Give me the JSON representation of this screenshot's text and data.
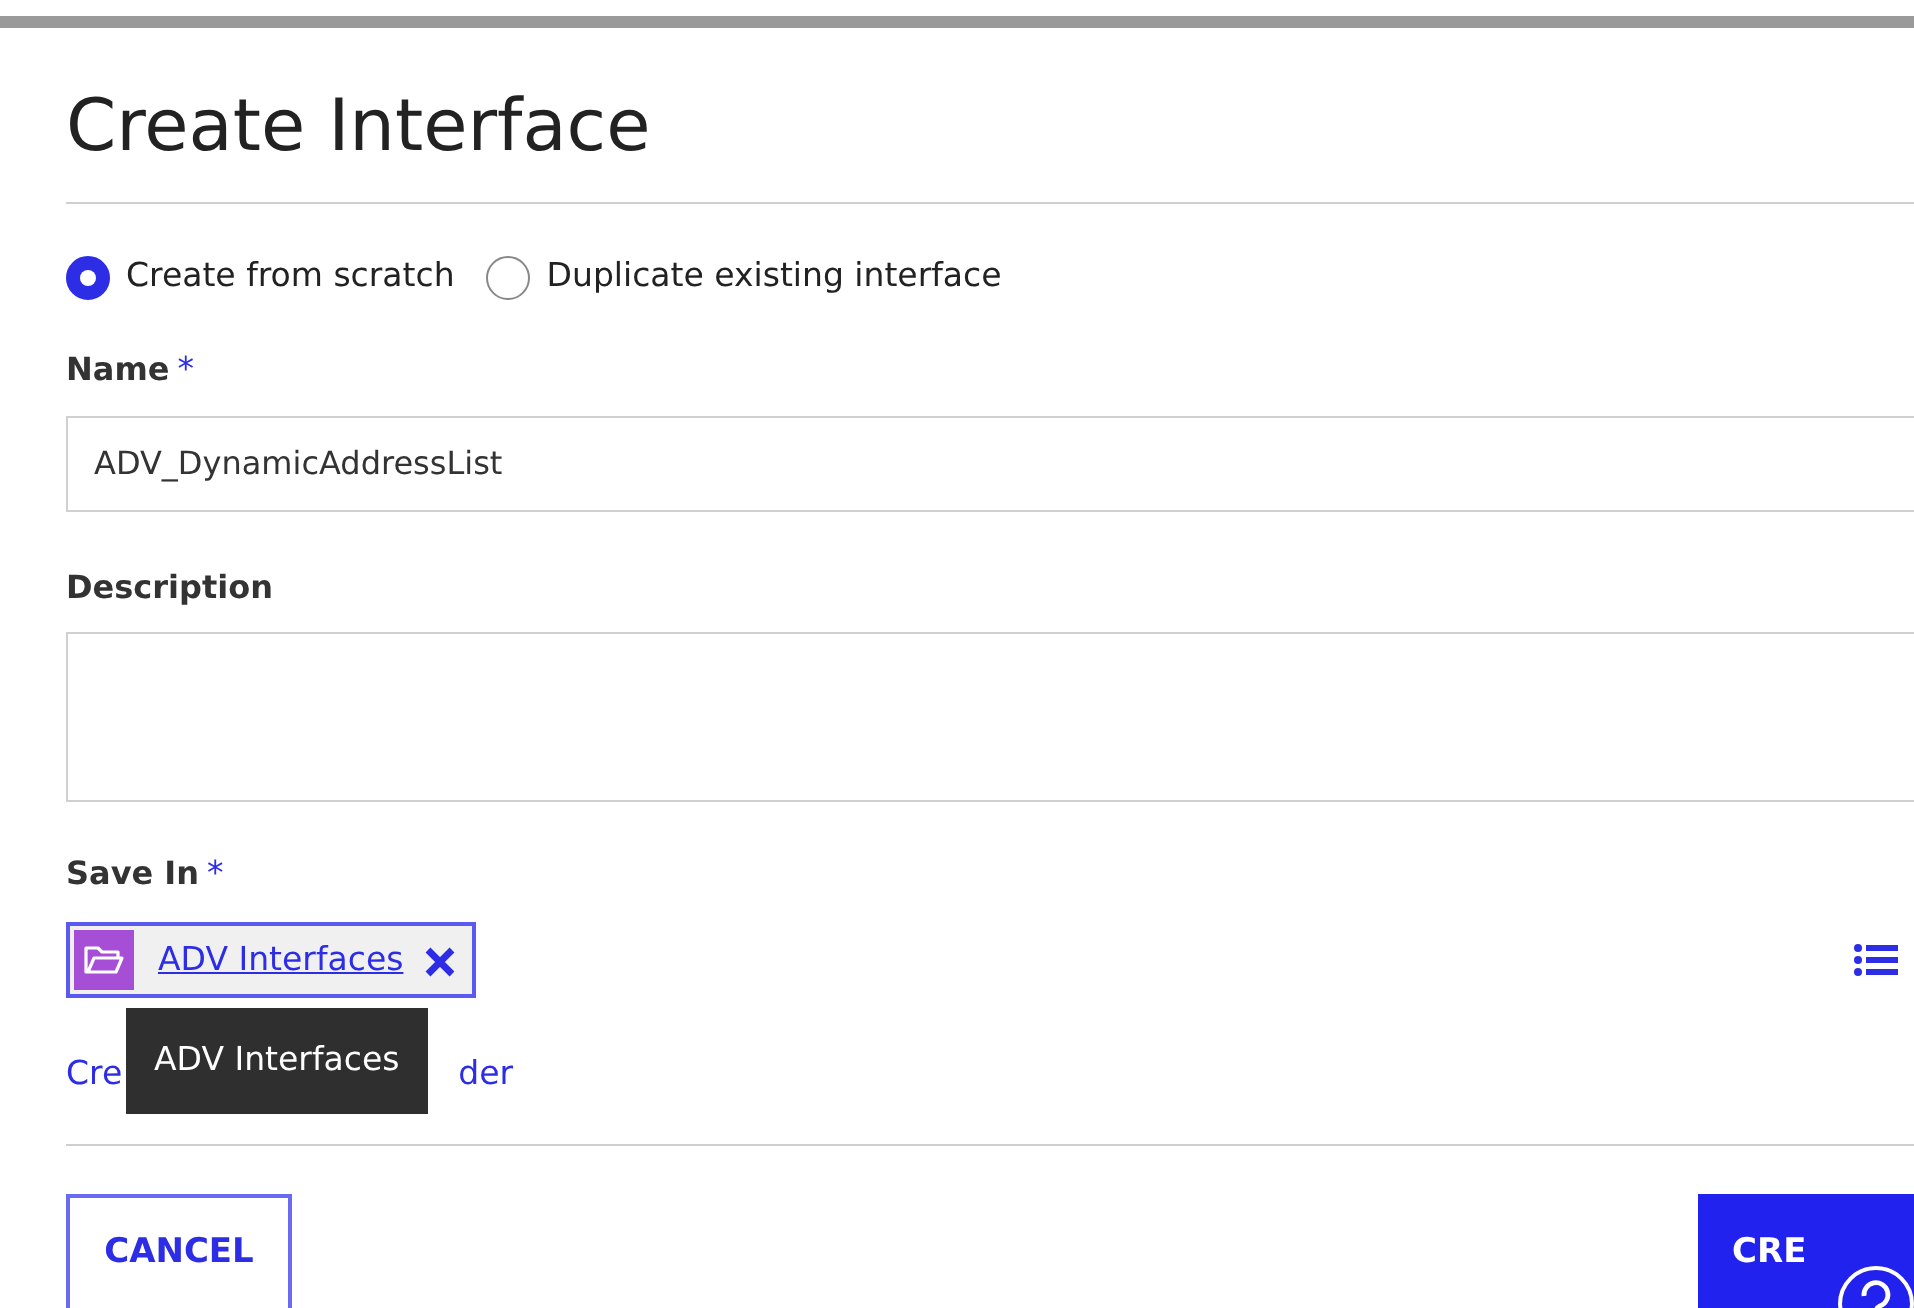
{
  "title": "Create Interface",
  "mode_options": [
    {
      "label": "Create from scratch",
      "selected": true
    },
    {
      "label": "Duplicate existing interface",
      "selected": false
    }
  ],
  "name_field": {
    "label": "Name",
    "required_mark": "*",
    "value": "ADV_DynamicAddressList"
  },
  "description_field": {
    "label": "Description"
  },
  "save_in": {
    "label": "Save In",
    "required_mark": "*",
    "folder": "ADV Interfaces",
    "tooltip": "ADV Interfaces",
    "create_link_parts": [
      "Cre",
      "der"
    ]
  },
  "buttons": [
    {
      "kind": "secondary",
      "label": "CANCEL"
    },
    {
      "kind": "primary",
      "label": "CRE"
    }
  ]
}
